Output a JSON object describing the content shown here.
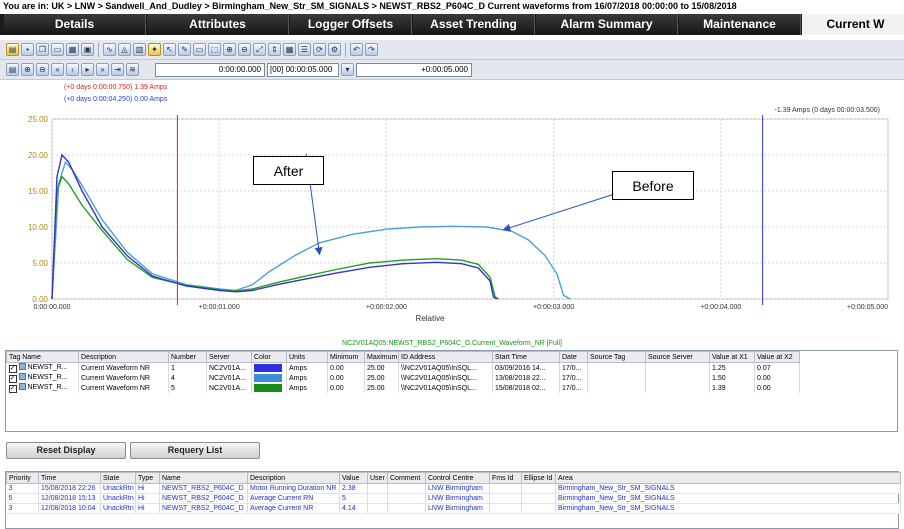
{
  "breadcrumb": "You are in: UK > LNW > Sandwell_And_Dudley > Birmingham_New_Str_SM_SIGNALS > NEWST_RBS2_P604C_D Current waveforms from 16/07/2018 00:00:00 to 15/08/2018",
  "tabs": [
    {
      "label": "Details",
      "width": 142
    },
    {
      "label": "Attributes",
      "width": 142
    },
    {
      "label": "Logger Offsets",
      "width": 122
    },
    {
      "label": "Asset Trending",
      "width": 122
    },
    {
      "label": "Alarm Summary",
      "width": 142
    },
    {
      "label": "Maintenance",
      "width": 122
    },
    {
      "label": "Current W",
      "width": 108,
      "active": true
    }
  ],
  "toolbar2": {
    "time_start": "0:00:00.000",
    "time_span": "[00] 00:00:05.000",
    "time_end": "+0:00:05.000"
  },
  "chart_data": {
    "type": "line",
    "xlabel": "Relative",
    "x_ticks": [
      "0:00:00.000",
      "+0:00:01.000",
      "+0:00:02.000",
      "+0:00:03.000",
      "+0:00:04.000",
      "+0:00:05.000"
    ],
    "y_ticks": [
      "0.00",
      "5.00",
      "10.00",
      "15.00",
      "20.00",
      "25.00"
    ],
    "xlim": [
      0,
      5
    ],
    "ylim": [
      0,
      25
    ],
    "cursor1": {
      "label": "(+0 days 0:00:00.750) 1.39 Amps",
      "x": 0.75,
      "color": "#e02020"
    },
    "cursor2": {
      "label": "(+0 days 0:00:04.250) 0.00 Amps",
      "x": 4.25,
      "color": "#2a38e0"
    },
    "cursor_right_label": "-1.39 Amps (0 days 00:00:03.500)",
    "series": [
      {
        "color": "#4aa0d8",
        "points": [
          [
            0,
            0
          ],
          [
            0.04,
            16
          ],
          [
            0.08,
            19
          ],
          [
            0.12,
            18
          ],
          [
            0.2,
            15
          ],
          [
            0.3,
            11
          ],
          [
            0.45,
            6.5
          ],
          [
            0.6,
            3.5
          ],
          [
            0.8,
            2
          ],
          [
            1.0,
            1.4
          ],
          [
            1.1,
            1.2
          ],
          [
            1.2,
            2
          ],
          [
            1.3,
            3.8
          ],
          [
            1.45,
            6
          ],
          [
            1.6,
            7.8
          ],
          [
            1.8,
            9
          ],
          [
            2.0,
            9.7
          ],
          [
            2.2,
            10
          ],
          [
            2.4,
            10.1
          ],
          [
            2.6,
            10
          ],
          [
            2.75,
            9.4
          ],
          [
            2.85,
            8.2
          ],
          [
            2.95,
            6
          ],
          [
            3.02,
            3.5
          ],
          [
            3.06,
            0.5
          ],
          [
            3.1,
            0
          ]
        ]
      },
      {
        "color": "#20a020",
        "points": [
          [
            0,
            0
          ],
          [
            0.03,
            15
          ],
          [
            0.06,
            17
          ],
          [
            0.1,
            16
          ],
          [
            0.18,
            13
          ],
          [
            0.3,
            9.5
          ],
          [
            0.45,
            5.5
          ],
          [
            0.6,
            3
          ],
          [
            0.8,
            1.9
          ],
          [
            1.0,
            1.3
          ],
          [
            1.1,
            1.1
          ],
          [
            1.2,
            1.4
          ],
          [
            1.35,
            2.3
          ],
          [
            1.5,
            3.1
          ],
          [
            1.7,
            4.1
          ],
          [
            1.9,
            5
          ],
          [
            2.1,
            5.4
          ],
          [
            2.3,
            5.6
          ],
          [
            2.45,
            5.4
          ],
          [
            2.55,
            4.8
          ],
          [
            2.62,
            3
          ],
          [
            2.65,
            0.3
          ],
          [
            2.67,
            0
          ]
        ]
      },
      {
        "color": "#3434c8",
        "points": [
          [
            0,
            0
          ],
          [
            0.03,
            17
          ],
          [
            0.06,
            20
          ],
          [
            0.1,
            19
          ],
          [
            0.18,
            15
          ],
          [
            0.3,
            10
          ],
          [
            0.45,
            6
          ],
          [
            0.6,
            3.2
          ],
          [
            0.8,
            1.8
          ],
          [
            1.0,
            1.2
          ],
          [
            1.1,
            1.0
          ],
          [
            1.2,
            1.2
          ],
          [
            1.35,
            2
          ],
          [
            1.5,
            2.7
          ],
          [
            1.7,
            3.6
          ],
          [
            1.9,
            4.4
          ],
          [
            2.1,
            4.9
          ],
          [
            2.3,
            5.1
          ],
          [
            2.45,
            4.9
          ],
          [
            2.55,
            4.3
          ],
          [
            2.62,
            2.5
          ],
          [
            2.64,
            0.3
          ],
          [
            2.66,
            0
          ]
        ]
      }
    ],
    "annotations": [
      {
        "label": "After",
        "arrow_from_x": 1.52,
        "arrow_from_y": 20.2,
        "arrow_to_x": 1.6,
        "arrow_to_y": 6.2
      },
      {
        "label": "Before",
        "arrow_from_x": 3.5,
        "arrow_from_y": 15.6,
        "arrow_to_x": 2.7,
        "arrow_to_y": 9.6
      }
    ]
  },
  "tags": {
    "title": "NC2V01AQ05:NEWST_RBS2_P604C_D.Current_Waveform_NR [Full]",
    "columns": [
      {
        "label": "Tag Name",
        "w": 72
      },
      {
        "label": "Description",
        "w": 90
      },
      {
        "label": "Number",
        "w": 38
      },
      {
        "label": "Server",
        "w": 45
      },
      {
        "label": "Color",
        "w": 35
      },
      {
        "label": "Units",
        "w": 41
      },
      {
        "label": "Minimum",
        "w": 37
      },
      {
        "label": "Maximum",
        "w": 34
      },
      {
        "label": "ID Address",
        "w": 94
      },
      {
        "label": "Start Time",
        "w": 67
      },
      {
        "label": "Date",
        "w": 28
      },
      {
        "label": "Source Tag",
        "w": 58
      },
      {
        "label": "Source Server",
        "w": 64
      },
      {
        "label": "Value at X1",
        "w": 45
      },
      {
        "label": "Value at X2",
        "w": 45
      }
    ],
    "rows": [
      {
        "checked": "✓",
        "name": "NEWST_R...",
        "desc": "Current Waveform NR",
        "number": "1",
        "server": "NC2V01A...",
        "color": "#2f2fe6",
        "units": "Amps",
        "min": "0.00",
        "max": "25.00",
        "address": "\\\\NC2V01AQ05\\InSQL...",
        "start": "03/09/2016 14...",
        "date": "17/0...",
        "source_tag": "",
        "source_server": "",
        "x1": "1.25",
        "x2": "0.07"
      },
      {
        "checked": "✓",
        "name": "NEWST_R...",
        "desc": "Current Waveform NR",
        "number": "4",
        "server": "NC2V01A...",
        "color": "#3c8fd6",
        "units": "Amps",
        "min": "0.00",
        "max": "25.00",
        "address": "\\\\NC2V01AQ05\\InSQL...",
        "start": "13/08/2018 22...",
        "date": "17/0...",
        "source_tag": "",
        "source_server": "",
        "x1": "1.50",
        "x2": "0.00"
      },
      {
        "checked": "✓",
        "name": "NEWST_R...",
        "desc": "Current Waveform NR",
        "number": "5",
        "server": "NC2V01A...",
        "color": "#1a8a1a",
        "units": "Amps",
        "min": "0.00",
        "max": "25.00",
        "address": "\\\\NC2V01AQ05\\InSQL...",
        "start": "15/08/2018 02...",
        "date": "17/0...",
        "source_tag": "",
        "source_server": "",
        "x1": "1.39",
        "x2": "0.00"
      }
    ]
  },
  "buttons": {
    "reset": "Reset Display",
    "requery": "Requery List"
  },
  "alarms": {
    "columns": [
      {
        "label": "Priority",
        "w": 32
      },
      {
        "label": "Time",
        "w": 62
      },
      {
        "label": "State",
        "w": 35
      },
      {
        "label": "Type",
        "w": 24
      },
      {
        "label": "Name",
        "w": 88
      },
      {
        "label": "Description",
        "w": 92
      },
      {
        "label": "Value",
        "w": 28
      },
      {
        "label": "User",
        "w": 20
      },
      {
        "label": "Comment",
        "w": 38
      },
      {
        "label": "Control Centre",
        "w": 64
      },
      {
        "label": "Fms Id",
        "w": 32
      },
      {
        "label": "Ellipse Id",
        "w": 34
      },
      {
        "label": "Area",
        "w": 345
      }
    ],
    "rows": [
      {
        "priority": "3",
        "time": "15/08/2018 22:26",
        "state": "UnackRtn",
        "type": "Hi",
        "name": "NEWST_RBS2_P604C_D",
        "desc": "Motor Running Duration NR",
        "value": "2.38",
        "user": "",
        "comment": "",
        "centre": "LNW Birmingham",
        "fms": "",
        "ellipse": "",
        "area": "Birmingham_New_Str_SM_SIGNALS"
      },
      {
        "priority": "5",
        "time": "12/08/2018 15:13",
        "state": "UnackRtn",
        "type": "Hi",
        "name": "NEWST_RBS2_P604C_D",
        "desc": "Average Current RN",
        "value": "5",
        "user": "",
        "comment": "",
        "centre": "LNW Birmingham",
        "fms": "",
        "ellipse": "",
        "area": "Birmingham_New_Str_SM_SIGNALS"
      },
      {
        "priority": "3",
        "time": "12/08/2018 10:04",
        "state": "UnackRtn",
        "type": "Hi",
        "name": "NEWST_RBS2_P604C_D",
        "desc": "Average Current NR",
        "value": "4.14",
        "user": "",
        "comment": "",
        "centre": "LNW Birmingham",
        "fms": "",
        "ellipse": "",
        "area": "Birmingham_New_Str_SM_SIGNALS"
      }
    ]
  }
}
